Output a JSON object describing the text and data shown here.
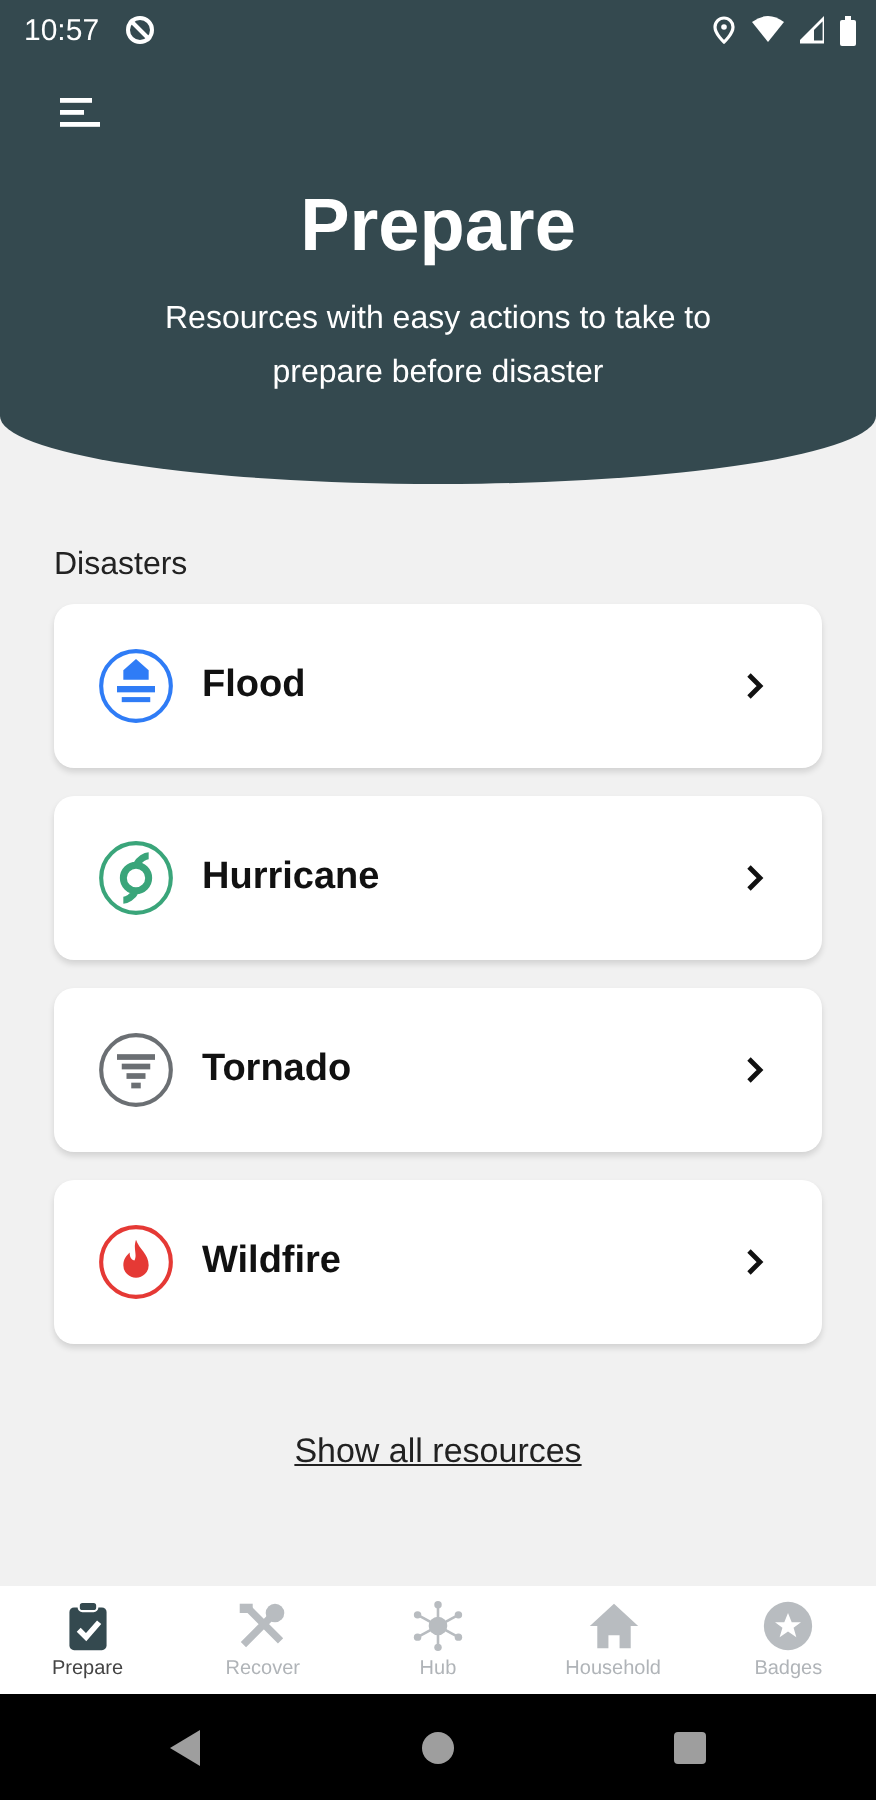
{
  "status_bar": {
    "time": "10:57"
  },
  "header": {
    "title": "Prepare",
    "subtitle": "Resources with easy actions to take to prepare before disaster"
  },
  "section_label": "Disasters",
  "disasters": [
    {
      "name": "Flood",
      "kind": "flood",
      "color": "#2f7cf6"
    },
    {
      "name": "Hurricane",
      "kind": "hurricane",
      "color": "#3aa57a"
    },
    {
      "name": "Tornado",
      "kind": "tornado",
      "color": "#6b6f73"
    },
    {
      "name": "Wildfire",
      "kind": "wildfire",
      "color": "#e53935"
    }
  ],
  "link": "Show all resources",
  "nav": [
    {
      "label": "Prepare",
      "kind": "clipboard",
      "selected": true
    },
    {
      "label": "Recover",
      "kind": "tools",
      "selected": false
    },
    {
      "label": "Hub",
      "kind": "hub",
      "selected": false
    },
    {
      "label": "Household",
      "kind": "house",
      "selected": false
    },
    {
      "label": "Badges",
      "kind": "badge",
      "selected": false
    }
  ]
}
